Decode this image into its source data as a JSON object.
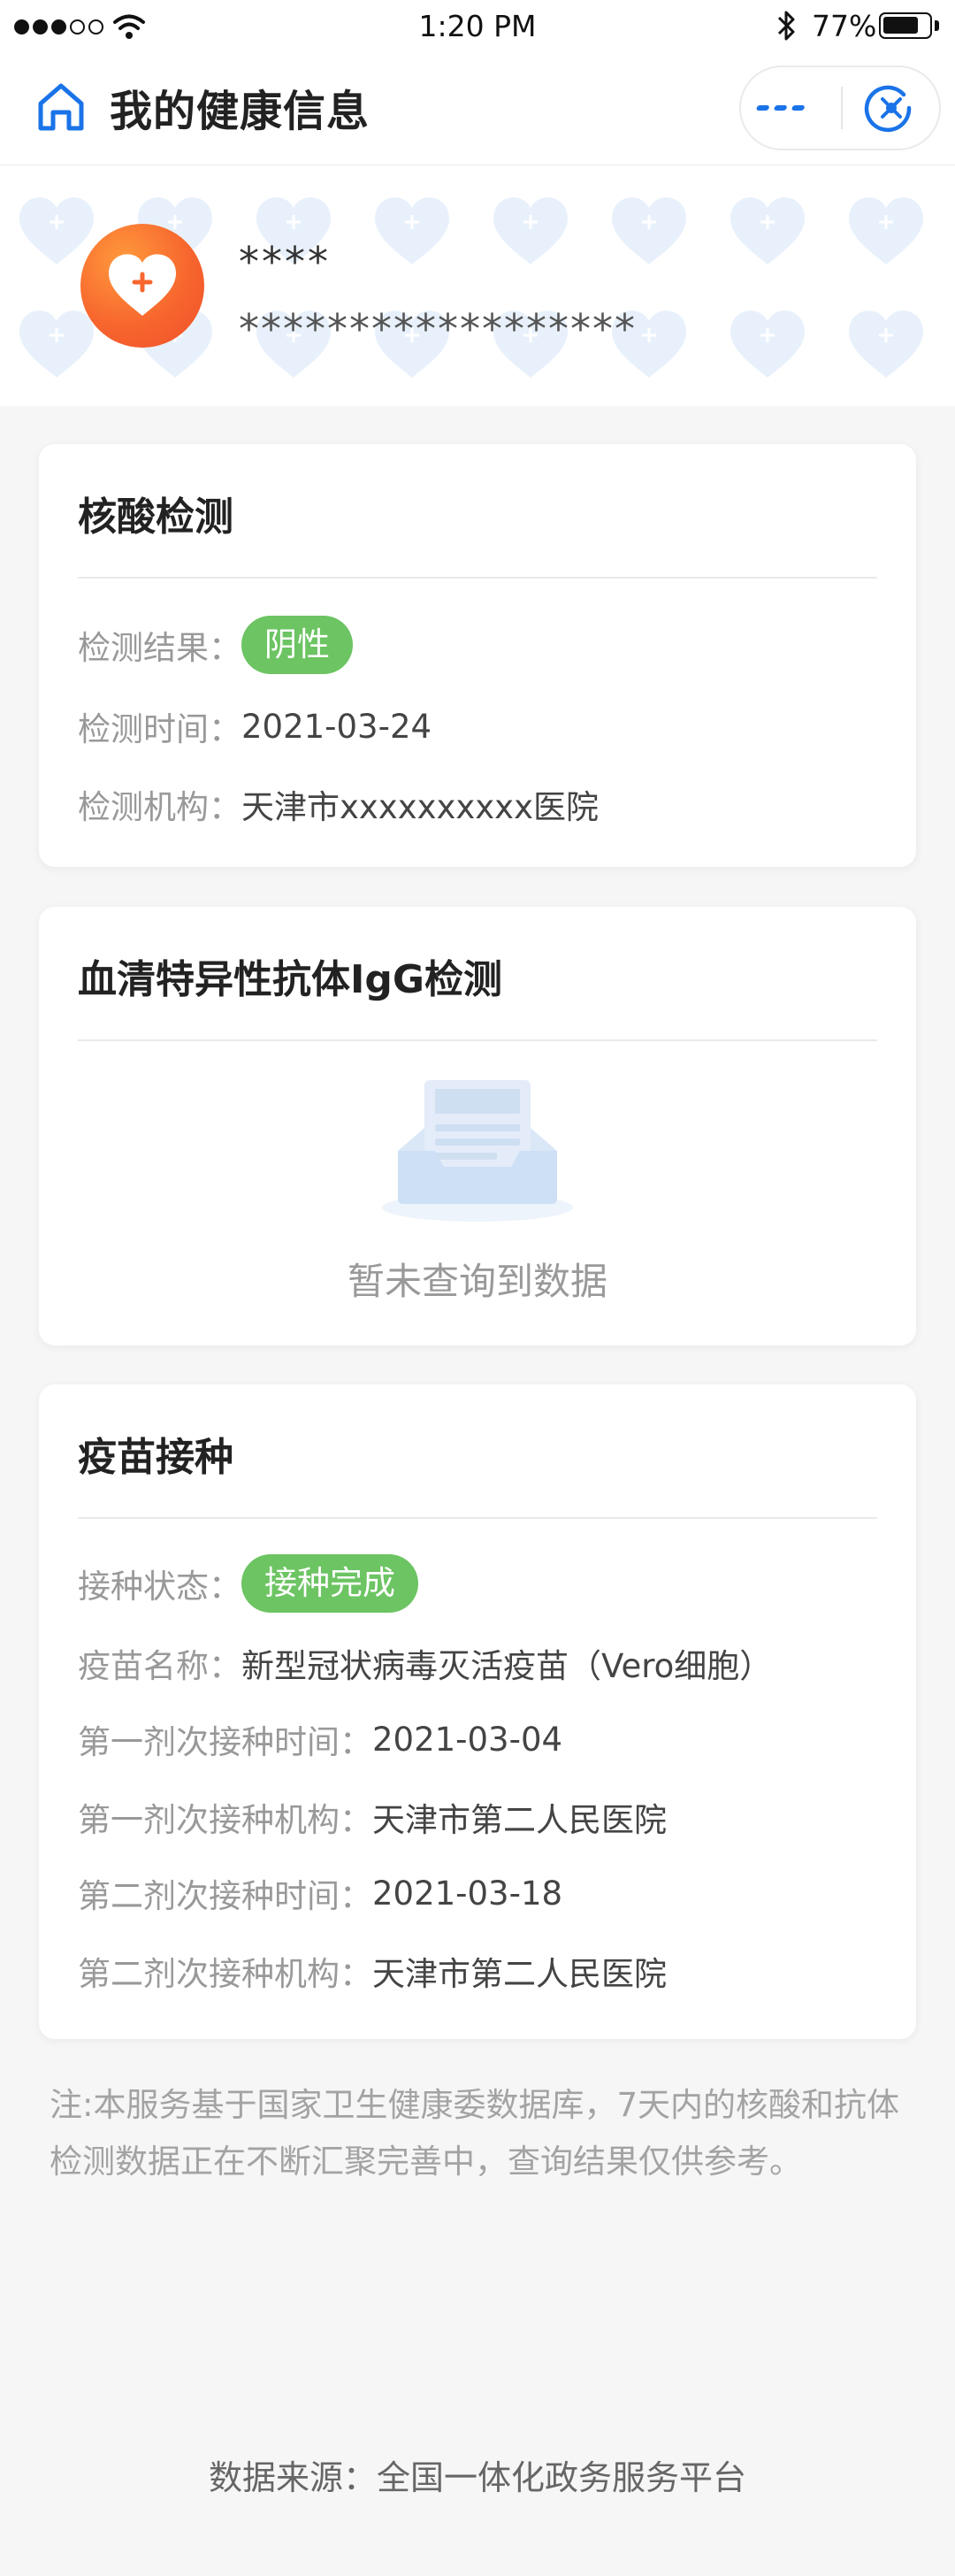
{
  "status_bar": {
    "time": "1:20 PM",
    "battery_percent": "77%",
    "battery_level": 0.77,
    "signal_bars_filled": 3,
    "signal_bars_total": 5
  },
  "nav": {
    "title": "我的健康信息",
    "accent_color": "#1a73e8"
  },
  "profile": {
    "name": "****",
    "id_number": "******************",
    "avatar_icon": "heart-plus-icon"
  },
  "nucleic_acid": {
    "title": "核酸检测",
    "rows": [
      {
        "label": "检测结果：",
        "value": "阴性",
        "badge": true
      },
      {
        "label": "检测时间：",
        "value": "2021-03-24"
      },
      {
        "label": "检测机构：",
        "value": "天津市xxxxxxxxxx医院"
      }
    ]
  },
  "antibody": {
    "title": "血清特异性抗体IgG检测",
    "empty_text": "暂未查询到数据",
    "empty_icon": "empty-inbox-icon"
  },
  "vaccine": {
    "title": "疫苗接种",
    "rows": [
      {
        "label": "接种状态：",
        "value": "接种完成",
        "badge": true
      },
      {
        "label": "疫苗名称：",
        "value": "新型冠状病毒灭活疫苗（Vero细胞）"
      },
      {
        "label": "第一剂次接种时间：",
        "value": "2021-03-04"
      },
      {
        "label": "第一剂次接种机构：",
        "value": "天津市第二人民医院"
      },
      {
        "label": "第二剂次接种时间：",
        "value": "2021-03-18"
      },
      {
        "label": "第二剂次接种机构：",
        "value": "天津市第二人民医院"
      }
    ]
  },
  "footnote": "注:本服务基于国家卫生健康委数据库，7天内的核酸和抗体检测数据正在不断汇聚完善中，查询结果仅供参考。",
  "source": "数据来源：全国一体化政务服务平台",
  "colors": {
    "badge_green": "#6cc462",
    "avatar_orange": "#f7662e",
    "background": "#f6f6f6"
  }
}
